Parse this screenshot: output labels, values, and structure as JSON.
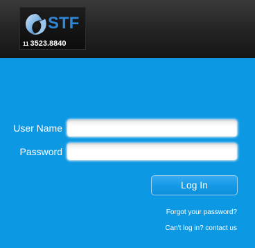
{
  "brand": {
    "name": "STF",
    "phone_area": "11",
    "phone_number": "3523.8840",
    "icon": "swirl-logo-icon",
    "accent_color": "#2f86d6"
  },
  "form": {
    "username_label": "User Name",
    "username_value": "",
    "password_label": "Password",
    "password_value": "",
    "login_label": "Log In",
    "forgot_link": "Forgot your password?",
    "contact_link": "Can't log in? contact us"
  },
  "colors": {
    "header_bg": "#232323",
    "panel_bg": "#0d98e3",
    "button_bg": "#139be7",
    "text": "#ffffff"
  }
}
